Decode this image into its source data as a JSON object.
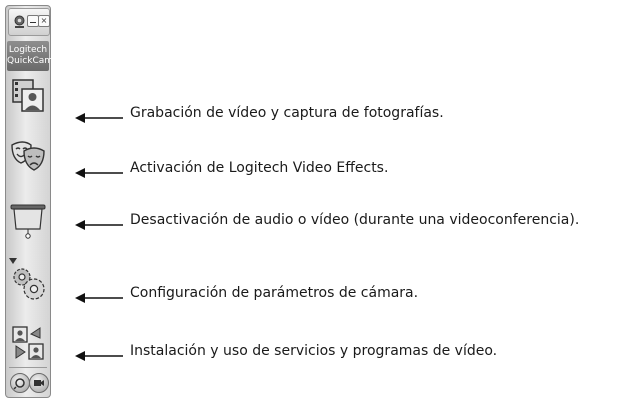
{
  "panel": {
    "brand_line1": "Logitech",
    "brand_line2": "QuickCam",
    "window_buttons": {
      "minimize": "",
      "close": "×"
    },
    "tools": [
      {
        "name": "video-photo-capture-icon"
      },
      {
        "name": "video-effects-masks-icon"
      },
      {
        "name": "mute-audio-video-icon"
      },
      {
        "name": "camera-settings-gears-icon"
      },
      {
        "name": "video-services-icon"
      }
    ],
    "bottom_buttons": [
      "help-icon",
      "webcam-icon"
    ]
  },
  "callouts": [
    {
      "text": "Grabación de vídeo y captura de fotografías."
    },
    {
      "text": "Activación de Logitech Video Effects."
    },
    {
      "text": "Desactivación de audio o vídeo (durante una videoconferencia)."
    },
    {
      "text": "Configuración de parámetros de cámara."
    },
    {
      "text": "Instalación y uso de servicios y programas de vídeo."
    }
  ],
  "colors": {
    "panel_light": "#ececec",
    "panel_dark": "#c9c9c9",
    "brand_bg": "#7a7a7a",
    "text": "#1a1a1a"
  }
}
